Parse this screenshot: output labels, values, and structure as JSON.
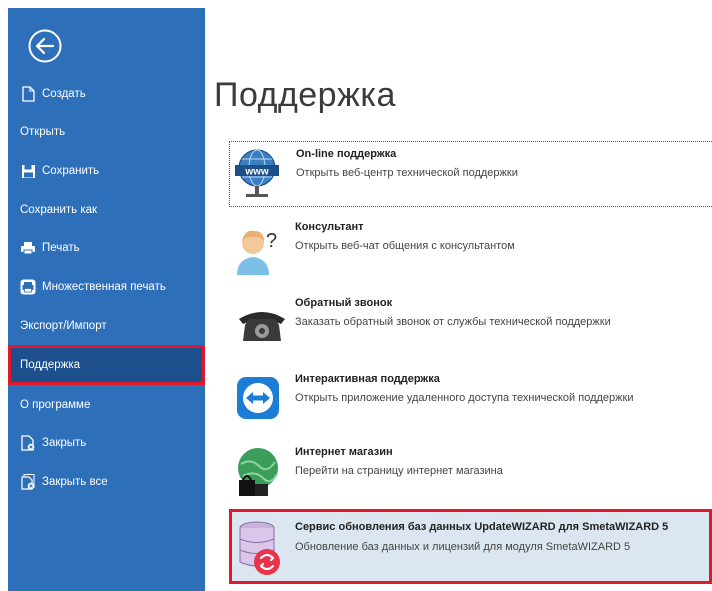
{
  "page": {
    "title": "Поддержка"
  },
  "sidebar": {
    "items": [
      {
        "label": "Создать",
        "icon": "new-file-icon"
      },
      {
        "label": "Открыть",
        "icon": ""
      },
      {
        "label": "Сохранить",
        "icon": "save-icon"
      },
      {
        "label": "Сохранить как",
        "icon": ""
      },
      {
        "label": "Печать",
        "icon": "print-icon"
      },
      {
        "label": "Множественная печать",
        "icon": "multi-print-icon"
      },
      {
        "label": "Экспорт/Импорт",
        "icon": ""
      },
      {
        "label": "Поддержка",
        "icon": "",
        "active": true
      },
      {
        "label": "О программе",
        "icon": ""
      },
      {
        "label": "Закрыть",
        "icon": "close-file-icon"
      },
      {
        "label": "Закрыть все",
        "icon": "close-all-icon"
      }
    ]
  },
  "options": [
    {
      "title": "On-line поддержка",
      "desc": "Открыть веб-центр технической поддержки",
      "icon": "globe-www-icon"
    },
    {
      "title": "Консультант",
      "desc": "Открыть веб-чат общения с консультантом",
      "icon": "consultant-icon"
    },
    {
      "title": "Обратный звонок",
      "desc": "Заказать обратный звонок от службы технической поддержки",
      "icon": "phone-icon"
    },
    {
      "title": "Интерактивная поддержка",
      "desc": "Открыть приложение удаленного доступа технической поддержки",
      "icon": "teamviewer-icon"
    },
    {
      "title": "Интернет магазин",
      "desc": "Перейти на страницу интернет магазина",
      "icon": "shop-icon"
    },
    {
      "title": "Сервис обновления баз данных UpdateWIZARD для SmetaWIZARD 5",
      "desc": "Обновление баз данных и лицензий для модуля SmetaWIZARD 5",
      "icon": "database-update-icon"
    }
  ],
  "colors": {
    "sidebar": "#2e6fba",
    "active": "#1d4f8d",
    "highlight": "#e0182c",
    "selected_bg": "#dce6f1"
  }
}
